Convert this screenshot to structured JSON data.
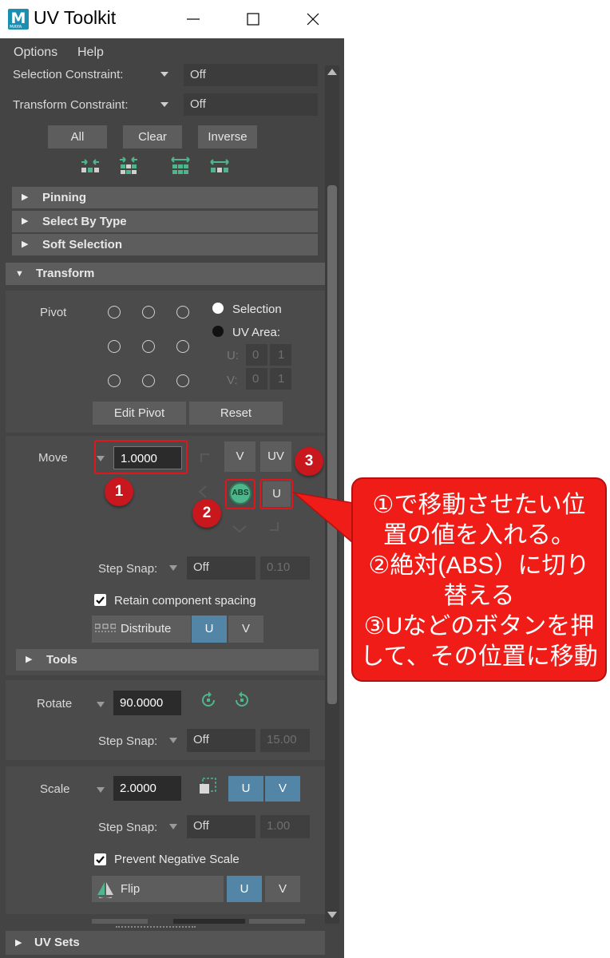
{
  "window": {
    "title": "UV Toolkit",
    "minimize": "—",
    "maximize": "☐",
    "close": "✕"
  },
  "menu": {
    "options": "Options",
    "help": "Help"
  },
  "selection_constraint": {
    "label": "Selection Constraint:",
    "value": "Off"
  },
  "transform_constraint": {
    "label": "Transform Constraint:",
    "value": "Off"
  },
  "select_buttons": {
    "all": "All",
    "clear": "Clear",
    "inverse": "Inverse"
  },
  "sections": {
    "pinning": "Pinning",
    "select_by_type": "Select By Type",
    "soft_selection": "Soft Selection",
    "transform": "Transform",
    "tools": "Tools",
    "uv_sets": "UV Sets"
  },
  "pivot": {
    "label": "Pivot",
    "selection": "Selection",
    "uv_area": "UV Area:",
    "u_label": "U:",
    "v_label": "V:",
    "u_values": [
      "0",
      "1"
    ],
    "v_values": [
      "0",
      "1"
    ],
    "edit_pivot": "Edit Pivot",
    "reset": "Reset"
  },
  "move": {
    "label": "Move",
    "value": "1.0000",
    "v_button": "V",
    "uv_button": "UV",
    "abs_button": "ABS",
    "u_button": "U",
    "step_snap_label": "Step Snap:",
    "step_snap_value": "Off",
    "step_snap_amount": "0.10",
    "retain_label": "Retain component spacing",
    "distribute_label": "Distribute",
    "dist_u": "U",
    "dist_v": "V"
  },
  "rotate": {
    "label": "Rotate",
    "value": "90.0000",
    "step_snap_label": "Step Snap:",
    "step_snap_value": "Off",
    "step_snap_amount": "15.00"
  },
  "scale": {
    "label": "Scale",
    "value": "2.0000",
    "u_button": "U",
    "v_button": "V",
    "step_snap_label": "Step Snap:",
    "step_snap_value": "Off",
    "step_snap_amount": "1.00",
    "prevent_label": "Prevent Negative Scale",
    "flip_label": "Flip",
    "flip_u": "U",
    "flip_v": "V"
  },
  "badges": [
    "1",
    "2",
    "3"
  ],
  "callout": {
    "lines": [
      "①で移動させたい位",
      "置の値を入れる。",
      "②絶対(ABS）に切り",
      "替える",
      "③Uなどのボタンを押",
      "して、その位置に移動"
    ]
  },
  "colors": {
    "annotation_red": "#e0161b",
    "accent_blue": "#5285a6",
    "icon_green": "#4fb68b"
  }
}
